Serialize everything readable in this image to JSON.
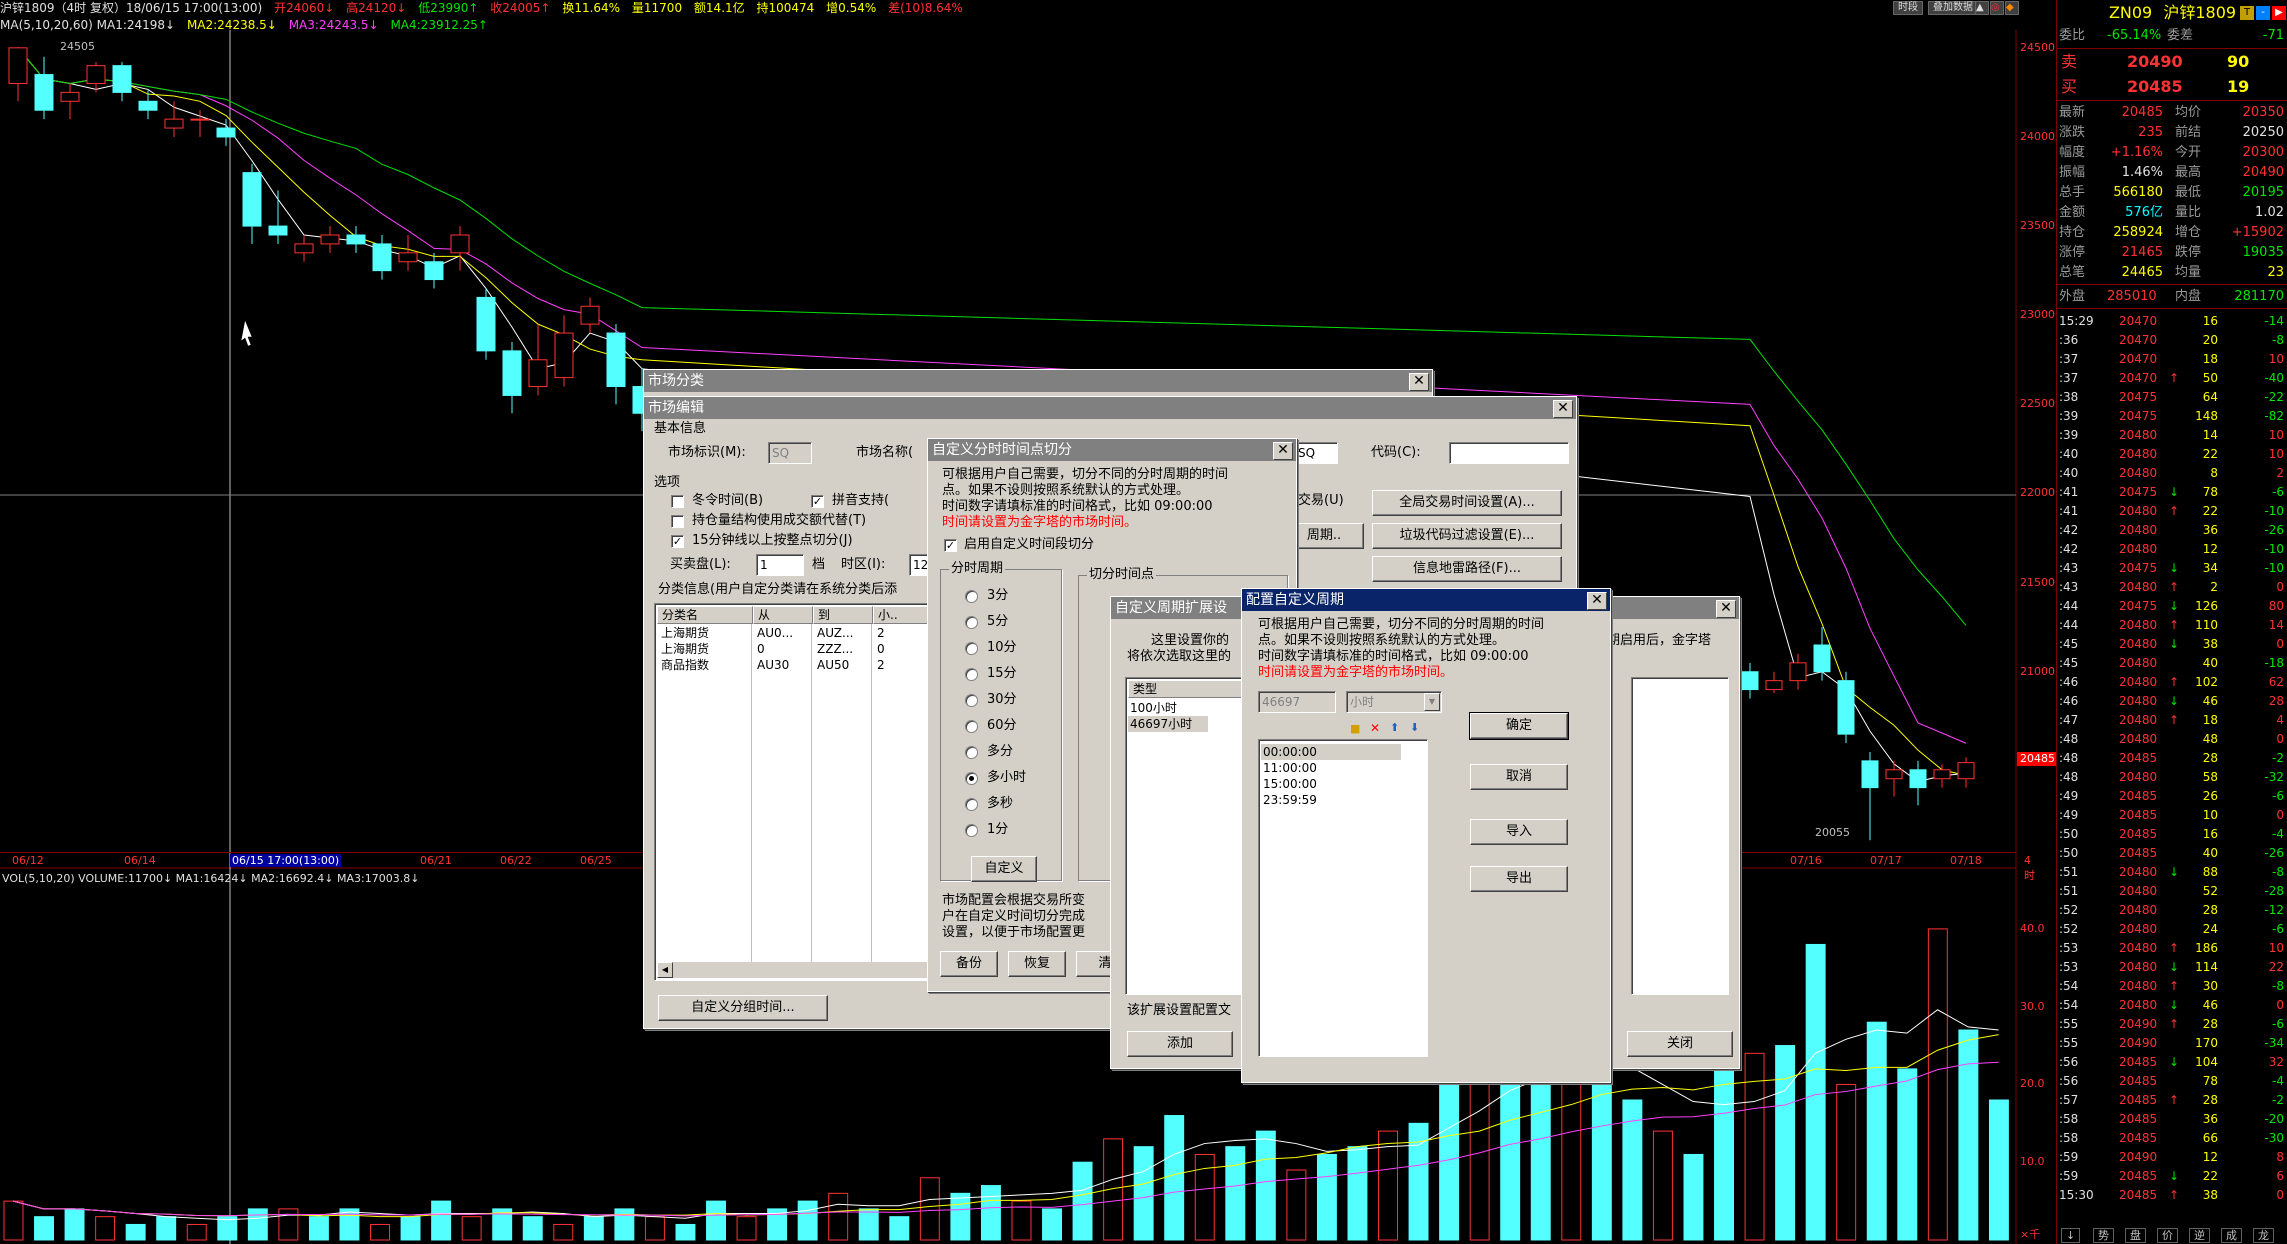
{
  "header": {
    "title_line": "沪锌1809（4时  复权）18/06/15 17:00(13:00)",
    "open": "开24060↓",
    "high": "高24120↓",
    "low": "低23990↑",
    "close": "收24005↑",
    "change": "换11.64%",
    "volume": "量11700",
    "amount": "额14.1亿",
    "hold": "持100474",
    "increase": "增0.54%",
    "extra": "差(10)8.64%",
    "ma_line": "MA(5,10,20,60)  MA1:24198↓",
    "ma2": "MA2:24238.5↓",
    "ma3": "MA3:24243.5↓",
    "ma4": "MA4:23912.25↑",
    "btn_time": "时段",
    "btn_cmp": "叠加数据"
  },
  "price_axis": [
    "24500",
    "24000",
    "23500",
    "23000",
    "22500",
    "22000",
    "21500",
    "21000"
  ],
  "price_axis_current": "20485",
  "chart_labels": {
    "high_mark": "24505",
    "low_mark": "20055"
  },
  "dates": [
    "06/12",
    "06/14",
    "06/15 17:00(13:00)",
    "06/21",
    "06/22",
    "06/25",
    "07/16",
    "07/17",
    "07/18"
  ],
  "date_axis_extra": "4时",
  "vol_header": "VOL(5,10,20)  VOLUME:11700↓ MA1:16424↓ MA2:16692.4↓ MA3:17003.8↓",
  "vol_axis": [
    "40.0",
    "30.0",
    "20.0",
    "10.0"
  ],
  "vol_unit": "×千",
  "chart_data": {
    "type": "candlestick",
    "title": "沪锌1809（4时  复权）",
    "ylim": [
      20000,
      24600
    ],
    "price_ticks": [
      24500,
      24000,
      23500,
      23000,
      22500,
      22000,
      21500,
      21000
    ],
    "candles": [
      {
        "o": 24300,
        "c": 24500,
        "h": 24505,
        "l": 24200
      },
      {
        "o": 24350,
        "c": 24150,
        "h": 24450,
        "l": 24100
      },
      {
        "o": 24200,
        "c": 24250,
        "h": 24300,
        "l": 24100
      },
      {
        "o": 24300,
        "c": 24400,
        "h": 24420,
        "l": 24250
      },
      {
        "o": 24400,
        "c": 24250,
        "h": 24420,
        "l": 24200
      },
      {
        "o": 24200,
        "c": 24150,
        "h": 24260,
        "l": 24100
      },
      {
        "o": 24050,
        "c": 24100,
        "h": 24200,
        "l": 24000
      },
      {
        "o": 24100,
        "c": 24100,
        "h": 24150,
        "l": 24000
      },
      {
        "o": 24050,
        "c": 24000,
        "h": 24100,
        "l": 23950
      },
      {
        "o": 23800,
        "c": 23500,
        "h": 23850,
        "l": 23400
      },
      {
        "o": 23500,
        "c": 23450,
        "h": 23700,
        "l": 23400
      },
      {
        "o": 23350,
        "c": 23400,
        "h": 23450,
        "l": 23300
      },
      {
        "o": 23400,
        "c": 23450,
        "h": 23500,
        "l": 23350
      },
      {
        "o": 23450,
        "c": 23400,
        "h": 23500,
        "l": 23350
      },
      {
        "o": 23400,
        "c": 23250,
        "h": 23450,
        "l": 23200
      },
      {
        "o": 23300,
        "c": 23350,
        "h": 23450,
        "l": 23250
      },
      {
        "o": 23300,
        "c": 23200,
        "h": 23350,
        "l": 23150
      },
      {
        "o": 23350,
        "c": 23450,
        "h": 23500,
        "l": 23250
      },
      {
        "o": 23100,
        "c": 22800,
        "h": 23150,
        "l": 22750
      },
      {
        "o": 22800,
        "c": 22550,
        "h": 22850,
        "l": 22450
      },
      {
        "o": 22600,
        "c": 22750,
        "h": 22950,
        "l": 22550
      },
      {
        "o": 22650,
        "c": 22900,
        "h": 23000,
        "l": 22600
      },
      {
        "o": 22950,
        "c": 23050,
        "h": 23100,
        "l": 22900
      },
      {
        "o": 22900,
        "c": 22600,
        "h": 22950,
        "l": 22500
      },
      {
        "o": 22600,
        "c": 22450,
        "h": 22700,
        "l": 22350
      }
    ],
    "tail_candles": [
      {
        "o": 21000,
        "c": 20900,
        "h": 21050,
        "l": 20850
      },
      {
        "o": 20900,
        "c": 20950,
        "h": 21000,
        "l": 20880
      },
      {
        "o": 20950,
        "c": 21050,
        "h": 21100,
        "l": 20900
      },
      {
        "o": 21150,
        "c": 21000,
        "h": 21250,
        "l": 20950
      },
      {
        "o": 20950,
        "c": 20650,
        "h": 21000,
        "l": 20600
      },
      {
        "o": 20500,
        "c": 20350,
        "h": 20550,
        "l": 20055
      },
      {
        "o": 20400,
        "c": 20450,
        "h": 20500,
        "l": 20300
      },
      {
        "o": 20450,
        "c": 20350,
        "h": 20500,
        "l": 20250
      },
      {
        "o": 20400,
        "c": 20450,
        "h": 20480,
        "l": 20350
      },
      {
        "o": 20400,
        "c": 20490,
        "h": 20520,
        "l": 20350
      }
    ],
    "volume": [
      5,
      3,
      4,
      3,
      2,
      3,
      2,
      3,
      4,
      4,
      3,
      4,
      2,
      3,
      5,
      3,
      4,
      3,
      2,
      3,
      4,
      3,
      2,
      5,
      3,
      4,
      5,
      6,
      4,
      3,
      8,
      6,
      7,
      5,
      4,
      10,
      13,
      12,
      16,
      11,
      12,
      14,
      9,
      11,
      12,
      14,
      15,
      20,
      22,
      25,
      22,
      24,
      22,
      18,
      14,
      11,
      22,
      24,
      25,
      38,
      20,
      28,
      22,
      40,
      27,
      18
    ]
  },
  "right_panel": {
    "code": "ZN09",
    "name": "沪锌1809",
    "wei_bi_label": "委比",
    "wei_bi": "-65.14%",
    "wei_cha_label": "委差",
    "wei_cha": "-71",
    "sell_label": "卖",
    "sell_price": "20490",
    "sell_vol": "90",
    "buy_label": "买",
    "buy_price": "20485",
    "buy_vol": "19",
    "stats": [
      {
        "l": "最新",
        "v": "20485",
        "vc": "red",
        "l2": "均价",
        "v2": "20350",
        "v2c": "red"
      },
      {
        "l": "涨跌",
        "v": "235",
        "vc": "red",
        "l2": "前结",
        "v2": "20250",
        "v2c": "wht"
      },
      {
        "l": "幅度",
        "v": "+1.16%",
        "vc": "red",
        "l2": "今开",
        "v2": "20300",
        "v2c": "red"
      },
      {
        "l": "振幅",
        "v": "1.46%",
        "vc": "wht",
        "l2": "最高",
        "v2": "20490",
        "v2c": "red"
      },
      {
        "l": "总手",
        "v": "566180",
        "vc": "yel",
        "l2": "最低",
        "v2": "20195",
        "v2c": "grn"
      },
      {
        "l": "金额",
        "v": "576亿",
        "vc": "cyn",
        "l2": "量比",
        "v2": "1.02",
        "v2c": "wht"
      },
      {
        "l": "持仓",
        "v": "258924",
        "vc": "yel",
        "l2": "增仓",
        "v2": "+15902",
        "v2c": "red"
      },
      {
        "l": "涨停",
        "v": "21465",
        "vc": "red",
        "l2": "跌停",
        "v2": "19035",
        "v2c": "grn"
      },
      {
        "l": "总笔",
        "v": "24465",
        "vc": "yel",
        "l2": "均量",
        "v2": "23",
        "v2c": "yel"
      }
    ],
    "outer_label": "外盘",
    "outer": "285010",
    "inner_label": "内盘",
    "inner": "281170",
    "ticks": [
      [
        "15:29",
        "20470",
        "",
        "16",
        "-14"
      ],
      [
        ":36",
        "20470",
        "",
        "20",
        "-8"
      ],
      [
        ":37",
        "20470",
        "",
        "18",
        "10"
      ],
      [
        ":37",
        "20470",
        "↑",
        "50",
        "-40"
      ],
      [
        ":38",
        "20475",
        "",
        "64",
        "-22"
      ],
      [
        ":39",
        "20475",
        "",
        "148",
        "-82"
      ],
      [
        ":39",
        "20480",
        "",
        "14",
        "10"
      ],
      [
        ":40",
        "20480",
        "",
        "22",
        "10"
      ],
      [
        ":40",
        "20480",
        "",
        "8",
        "2"
      ],
      [
        ":41",
        "20475",
        "↓",
        "78",
        "-6"
      ],
      [
        ":41",
        "20480",
        "↑",
        "22",
        "-10"
      ],
      [
        ":42",
        "20480",
        "",
        "36",
        "-26"
      ],
      [
        ":42",
        "20480",
        "",
        "12",
        "-10"
      ],
      [
        ":43",
        "20475",
        "↓",
        "34",
        "-10"
      ],
      [
        ":43",
        "20480",
        "↑",
        "2",
        "0"
      ],
      [
        ":44",
        "20475",
        "↓",
        "126",
        "80"
      ],
      [
        ":44",
        "20480",
        "↑",
        "110",
        "14"
      ],
      [
        ":45",
        "20480",
        "↓",
        "38",
        "0"
      ],
      [
        ":45",
        "20480",
        "",
        "40",
        "-18"
      ],
      [
        ":46",
        "20480",
        "↑",
        "102",
        "62"
      ],
      [
        ":46",
        "20480",
        "↓",
        "46",
        "28"
      ],
      [
        ":47",
        "20480",
        "↑",
        "18",
        "4"
      ],
      [
        ":48",
        "20480",
        "",
        "48",
        "0"
      ],
      [
        ":48",
        "20485",
        "",
        "28",
        "-2"
      ],
      [
        ":48",
        "20480",
        "",
        "58",
        "-32"
      ],
      [
        ":49",
        "20485",
        "",
        "26",
        "-6"
      ],
      [
        ":49",
        "20485",
        "",
        "10",
        "0"
      ],
      [
        ":50",
        "20485",
        "",
        "16",
        "-4"
      ],
      [
        ":50",
        "20485",
        "",
        "40",
        "-26"
      ],
      [
        ":51",
        "20480",
        "↓",
        "88",
        "-8"
      ],
      [
        ":51",
        "20480",
        "",
        "52",
        "-28"
      ],
      [
        ":52",
        "20480",
        "",
        "28",
        "-12"
      ],
      [
        ":52",
        "20480",
        "",
        "24",
        "-6"
      ],
      [
        ":53",
        "20480",
        "↑",
        "186",
        "10"
      ],
      [
        ":53",
        "20480",
        "↓",
        "114",
        "22"
      ],
      [
        ":54",
        "20480",
        "↑",
        "30",
        "-8"
      ],
      [
        ":54",
        "20480",
        "↓",
        "46",
        "0"
      ],
      [
        ":55",
        "20490",
        "↑",
        "28",
        "-6"
      ],
      [
        ":55",
        "20490",
        "",
        "170",
        "-34"
      ],
      [
        ":56",
        "20485",
        "↓",
        "104",
        "32"
      ],
      [
        ":56",
        "20485",
        "",
        "78",
        "-4"
      ],
      [
        ":57",
        "20485",
        "↑",
        "28",
        "-2"
      ],
      [
        ":58",
        "20485",
        "",
        "36",
        "-20"
      ],
      [
        ":58",
        "20485",
        "",
        "66",
        "-30"
      ],
      [
        ":59",
        "20490",
        "",
        "12",
        "8"
      ],
      [
        ":59",
        "20485",
        "↓",
        "22",
        "6"
      ],
      [
        "15:30",
        "20485",
        "↑",
        "38",
        "0"
      ]
    ],
    "bottom_tabs": [
      "↓",
      "势",
      "盘",
      "价",
      "逆",
      "成",
      "龙"
    ]
  },
  "dlg_market_class": {
    "title": "市场分类"
  },
  "dlg_market_edit": {
    "title": "市场编辑",
    "basic_info": "基本信息",
    "market_id_label": "市场标识(M):",
    "market_id_val": "SQ",
    "market_name_label": "市场名称(",
    "market_code_val": "SQ",
    "code_label": "代码(C):",
    "code_val": "",
    "options_label": "选项",
    "opt1": "冬令时间(B)",
    "opt2": "拼音支持(",
    "opt3": "持仓量结构使用成交额代替(T)",
    "opt4": "15分钟线以上按整点切分(J)",
    "trade_label": "交易(U)",
    "buy_sell_label": "买卖盘(L):",
    "buy_sell_val": "1",
    "level_label": "档",
    "tz_label": "时区(I):",
    "tz_val": "12",
    "class_info": "分类信息(用户自定分类请在系统分类后添",
    "cols": [
      "分类名",
      "从",
      "到",
      "小.."
    ],
    "rows": [
      [
        "上海期货",
        "AU0...",
        "AUZ...",
        "2"
      ],
      [
        "上海期货",
        "0",
        "ZZZ...",
        "0"
      ],
      [
        "商品指数",
        "AU30",
        "AU50",
        "2"
      ]
    ],
    "btn_global_time": "全局交易时间设置(A)...",
    "btn_period": "周期..",
    "btn_filter": "垃圾代码过滤设置(E)...",
    "btn_info_path": "信息地雷路径(F)...",
    "btn_group_time": "自定义分组时间..."
  },
  "dlg_time_split": {
    "title": "自定义分时时间点切分",
    "desc1": "可根据用户自己需要，切分不同的分时周期的时间",
    "desc2": "点。如果不设则按照系统默认的方式处理。",
    "desc3": "时间数字请填标准的时间格式，比如 09:00:00",
    "warn": "时间请设置为金字塔的市场时间。",
    "enable": "启用自定义时间段切分",
    "period_group": "分时周期",
    "periods": [
      "3分",
      "5分",
      "10分",
      "15分",
      "30分",
      "60分",
      "多分",
      "多小时",
      "多秒",
      "1分"
    ],
    "selected": 7,
    "custom_btn": "自定义",
    "split_group": "切分时间点",
    "note1": "市场配置会根据交易所变",
    "note2": "户在自定义时间切分完成",
    "note3": "设置，以便于市场配置更",
    "btn_backup": "备份",
    "btn_restore": "恢复",
    "btn_more": "清"
  },
  "dlg_ext": {
    "title": "自定义周期扩展设",
    "desc1": "这里设置你的",
    "desc2": "将依次选取这里的",
    "type_hdr": "类型",
    "types": [
      "100小时",
      "46697小时"
    ],
    "foot": "该扩展设置配置文",
    "btn_add": "添加",
    "right_text": "期启用后，金字塔",
    "btn_close": "关闭"
  },
  "dlg_config": {
    "title": "配置自定义周期",
    "desc1": "可根据用户自己需要，切分不同的分时周期的时间",
    "desc2": "点。如果不设则按照系统默认的方式处理。",
    "desc3": "时间数字请填标准的时间格式，比如 09:00:00",
    "warn": "时间请设置为金字塔的市场时间。",
    "num_val": "46697",
    "unit_val": "小时",
    "times": [
      "00:00:00",
      "11:00:00",
      "15:00:00",
      "23:59:59"
    ],
    "btn_ok": "确定",
    "btn_cancel": "取消",
    "btn_import": "导入",
    "btn_export": "导出"
  }
}
